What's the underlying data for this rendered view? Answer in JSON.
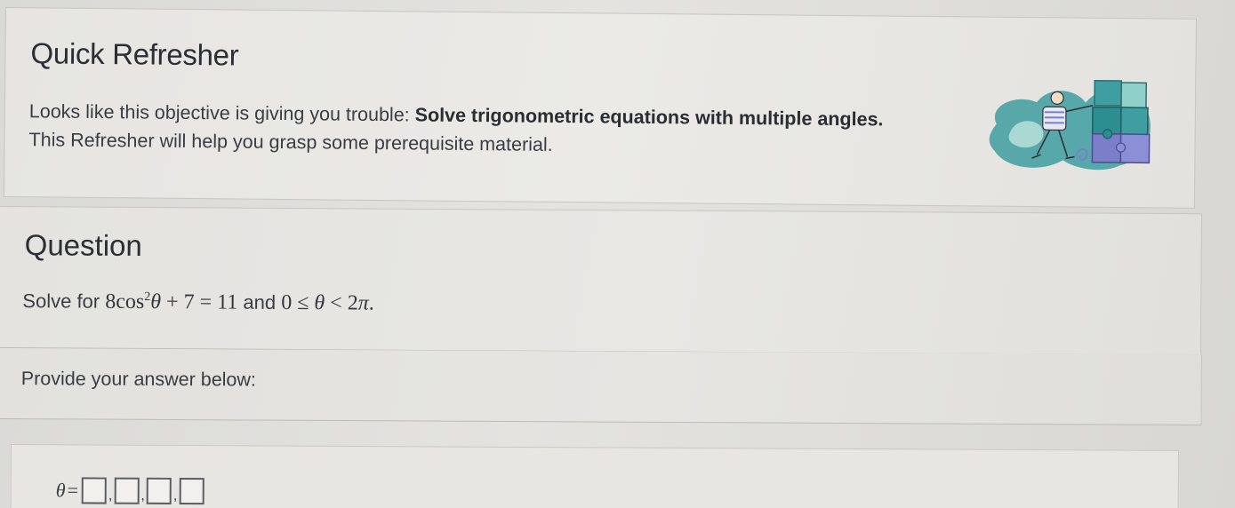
{
  "refresher": {
    "title": "Quick Refresher",
    "desc_prefix": "Looks like this objective is giving you trouble: ",
    "objective": "Solve trigonometric equations with multiple angles.",
    "desc_line2": "This Refresher will help you grasp some prerequisite material.",
    "illustration_icon": "puzzle-pieces-illustration"
  },
  "question": {
    "title": "Question",
    "prefix": "Solve for",
    "eq_coef": "8cos",
    "eq_exp": "2",
    "eq_var": "θ",
    "eq_rest": " + 7 = 11",
    "conjunction": "and",
    "domain_lhs": "0 ≤ ",
    "domain_var": "θ",
    "domain_rhs": " < 2",
    "domain_pi": "π",
    "domain_end": "."
  },
  "answer": {
    "prompt": "Provide your answer below:",
    "variable": "θ",
    "equals": "=",
    "separator": ",",
    "box_count": 4,
    "values": [
      "",
      "",
      "",
      ""
    ]
  },
  "colors": {
    "background": "#d9d9d6",
    "card": "#e6e5e2",
    "text": "#2f3237",
    "teal": "#3e9ea0",
    "purple": "#7b7fc9"
  }
}
